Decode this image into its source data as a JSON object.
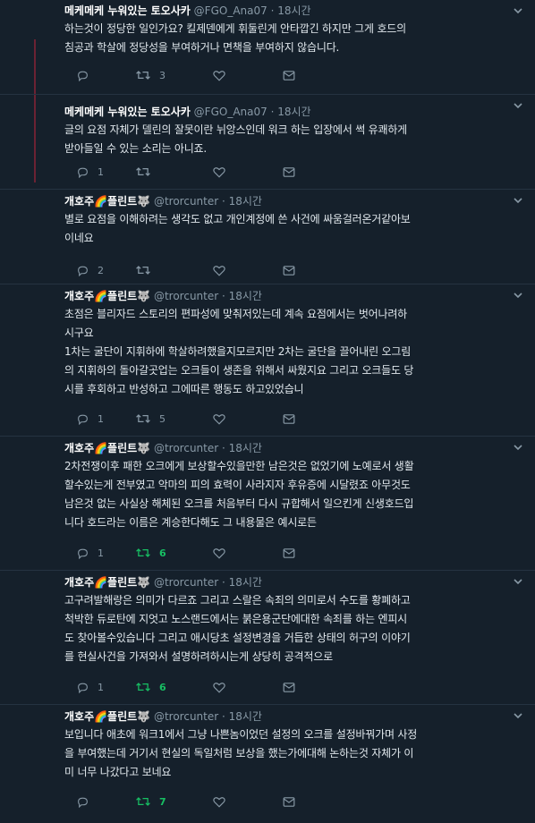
{
  "tweets": [
    {
      "user": {
        "name": "메케메케 누워있는 토오사카",
        "handle": "@FGO_Ana07",
        "time": "18시간",
        "avatar": "anime-avatar"
      },
      "lines": [
        "하는것이 정당한 일인가요? 킬제덴에게 휘둘린게 안타깝긴 하지만 그게 호드의",
        "침공과 학살에 정당성을 부여하거나 면책을 부여하지 않습니다."
      ],
      "reply_count": "",
      "retweet_count": "3",
      "like_count": "",
      "retweet_active": false
    },
    {
      "user": {
        "name": "메케메케 누워있는 토오사카",
        "handle": "@FGO_Ana07",
        "time": "18시간",
        "avatar": "anime-avatar"
      },
      "lines": [
        "글의 요점 자체가 델린의 잘못이란 뉘앙스인데 워크 하는 입장에서 썩 유쾌하게",
        "받아들일 수 있는 소리는 아니죠."
      ],
      "reply_count": "1",
      "retweet_count": "",
      "like_count": "",
      "retweet_active": false
    },
    {
      "user": {
        "name": "개호주🌈플린트🐺",
        "handle": "@trorcunter",
        "time": "18시간",
        "avatar": "orc-avatar"
      },
      "lines": [
        "별로 요점을 이해하려는 생각도 없고 개인계정에 쓴 사건에 싸움걸러온거같아보",
        "이네요"
      ],
      "reply_count": "2",
      "retweet_count": "",
      "like_count": "",
      "retweet_active": false
    },
    {
      "user": {
        "name": "개호주🌈플린트🐺",
        "handle": "@trorcunter",
        "time": "18시간",
        "avatar": "orc-avatar"
      },
      "lines": [
        "초점은 블리자드 스토리의 편파성에 맞춰저있는데 계속 요점에서는 벗어나려하",
        "시구요",
        "1차는 굴단이 지휘하에 학살하려했을지모르지만 2차는 굴단을 끌어내린 오그림",
        "의 지휘하의 돌아갈곳업는 오크들이 생존을 위해서 싸웠지요 그리고 오크들도 당",
        "시를 후회하고 반성하고 그에따른 행동도 하고있었습니"
      ],
      "reply_count": "1",
      "retweet_count": "5",
      "like_count": "",
      "retweet_active": false
    },
    {
      "user": {
        "name": "개호주🌈플린트🐺",
        "handle": "@trorcunter",
        "time": "18시간",
        "avatar": "orc-avatar"
      },
      "lines": [
        "2차전쟁이후 패한 오크에게 보상할수있을만한 남은것은 없었기에 노예로서 생활",
        "할수있는게 전부였고 악마의 피의 효력이 사라지자 후유증에 시달렸죠 아무것도",
        "남은것 없는 사실상 해체된 오크를 처음부터 다시 규합해서 일으킨게 신생호드입",
        "니다 호드라는 이름은 계승한다해도 그 내용물은 예시로든"
      ],
      "reply_count": "1",
      "retweet_count": "6",
      "like_count": "",
      "retweet_active": true
    },
    {
      "user": {
        "name": "개호주🌈플린트🐺",
        "handle": "@trorcunter",
        "time": "18시간",
        "avatar": "orc-avatar"
      },
      "lines": [
        "고구려발해랑은 의미가 다르죠  그리고 스랄은 속죄의 의미로서 수도를 황폐하고",
        "척박한 듀로탄에 지엇고 노스랜드에서는 붉은용군단에대한 속죄를 하는 엔피시",
        "도 찾아볼수있습니다 그리고 애시당초 설정변경을 거듭한 상태의 허구의 이야기",
        "를 현실사건을 가져와서 설명하려하시는게 상당히 공격적으로"
      ],
      "reply_count": "1",
      "retweet_count": "6",
      "like_count": "",
      "retweet_active": true
    },
    {
      "user": {
        "name": "개호주🌈플린트🐺",
        "handle": "@trorcunter",
        "time": "18시간",
        "avatar": "orc-avatar"
      },
      "lines": [
        "보입니다 애초에 워크1에서 그냥 나쁜놈이었던 설정의 오크를 설정바꿔가며 사정",
        "을 부여했는데 거기서 현실의 독일처럼 보상을 했는가에대해 논하는것 자체가 이",
        "미 너무 나갔다고 보네요"
      ],
      "reply_count": "",
      "retweet_count": "7",
      "like_count": "",
      "retweet_active": true
    }
  ]
}
